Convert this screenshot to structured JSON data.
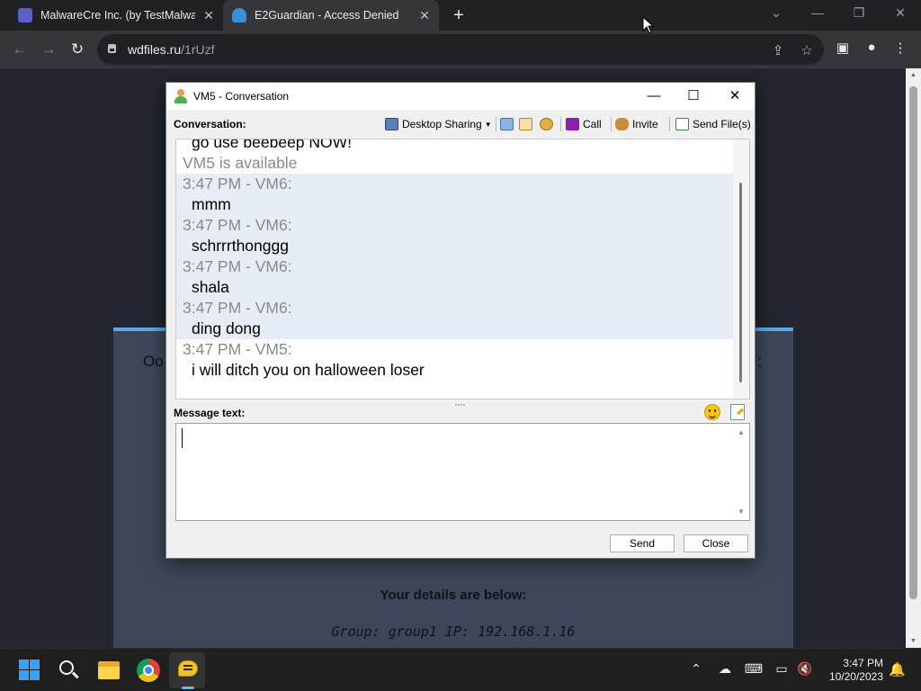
{
  "browser": {
    "tabs": [
      {
        "title": "MalwareCre Inc. (by TestMalware",
        "active": false
      },
      {
        "title": "E2Guardian - Access Denied",
        "active": true
      }
    ],
    "address": {
      "domain": "wdfiles.ru",
      "path": "/1rUzf"
    }
  },
  "page": {
    "heading_left": "Oo",
    "heading_right": ":",
    "details_label": "Your details are below:",
    "group_ip": "Group: group1   IP: 192.168.1.16"
  },
  "dialog": {
    "title": "VM5 - Conversation",
    "conversation_label": "Conversation:",
    "toolbar": {
      "desktop_sharing": "Desktop Sharing",
      "call": "Call",
      "invite": "Invite",
      "send_files": "Send File(s)"
    },
    "chat": [
      {
        "kind": "msg",
        "text": "go use beebeep NOW!",
        "highlight": false
      },
      {
        "kind": "meta",
        "text": "VM5 is available",
        "highlight": false
      },
      {
        "kind": "meta",
        "text": "3:47 PM - VM6:",
        "highlight": true
      },
      {
        "kind": "msg",
        "text": "mmm",
        "highlight": true
      },
      {
        "kind": "meta",
        "text": "3:47 PM - VM6:",
        "highlight": true
      },
      {
        "kind": "msg",
        "text": "schrrrthonggg",
        "highlight": true
      },
      {
        "kind": "meta",
        "text": "3:47 PM - VM6:",
        "highlight": true
      },
      {
        "kind": "msg",
        "text": "shala",
        "highlight": true
      },
      {
        "kind": "meta",
        "text": "3:47 PM - VM6:",
        "highlight": true
      },
      {
        "kind": "msg",
        "text": "ding dong",
        "highlight": true
      },
      {
        "kind": "meta",
        "text": "3:47 PM - VM5:",
        "highlight": false
      },
      {
        "kind": "msg",
        "text": "i will ditch you on halloween loser",
        "highlight": false
      }
    ],
    "message_label": "Message text:",
    "message_value": "",
    "send_label": "Send",
    "close_label": "Close"
  },
  "taskbar": {
    "time": "3:47 PM",
    "date": "10/20/2023"
  },
  "colors": {
    "accent": "#5aa8e6",
    "chat_highlight": "#e6edf6",
    "meta_text": "#8a8a8a"
  }
}
